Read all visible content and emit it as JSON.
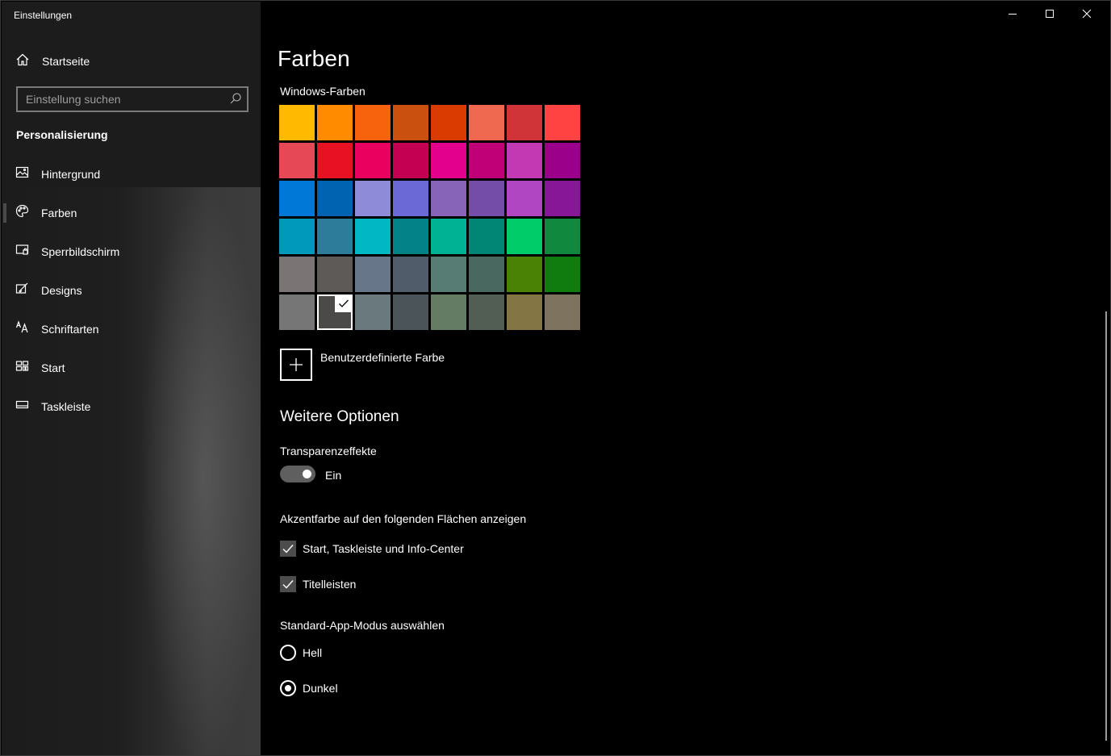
{
  "window": {
    "title": "Einstellungen"
  },
  "sidebar": {
    "home_label": "Startseite",
    "search_placeholder": "Einstellung suchen",
    "section_title": "Personalisierung",
    "items": [
      {
        "label": "Hintergrund",
        "icon": "picture-icon"
      },
      {
        "label": "Farben",
        "icon": "palette-icon",
        "active": true
      },
      {
        "label": "Sperrbildschirm",
        "icon": "lockscreen-icon"
      },
      {
        "label": "Designs",
        "icon": "brush-icon"
      },
      {
        "label": "Schriftarten",
        "icon": "font-icon"
      },
      {
        "label": "Start",
        "icon": "start-tiles-icon"
      },
      {
        "label": "Taskleiste",
        "icon": "taskbar-icon"
      }
    ]
  },
  "main": {
    "title": "Farben",
    "windows_colors_label": "Windows-Farben",
    "swatches": [
      [
        "#FFB900",
        "#FF8C00",
        "#F7630C",
        "#CA5010",
        "#DA3B01",
        "#EF6950",
        "#D13438",
        "#FF4343"
      ],
      [
        "#E74856",
        "#E81123",
        "#EA005E",
        "#C30052",
        "#E3008C",
        "#BF0077",
        "#C239B3",
        "#9A0089"
      ],
      [
        "#0078D7",
        "#0063B1",
        "#8E8CD8",
        "#6B69D6",
        "#8764B8",
        "#744DA9",
        "#B146C2",
        "#881798"
      ],
      [
        "#0099BC",
        "#2D7D9A",
        "#00B7C3",
        "#038387",
        "#00B294",
        "#018574",
        "#00CC6A",
        "#10893E"
      ],
      [
        "#7A7574",
        "#5D5A58",
        "#68768A",
        "#515C6B",
        "#567C73",
        "#486860",
        "#498205",
        "#107C10"
      ],
      [
        "#767676",
        "#4C4A48",
        "#69797E",
        "#4A5459",
        "#647C64",
        "#525E54",
        "#847545",
        "#7E735F"
      ]
    ],
    "selected_swatch": {
      "row": 5,
      "col": 1
    },
    "custom_color_label": "Benutzerdefinierte Farbe",
    "more_options_title": "Weitere Optionen",
    "transparency_label": "Transparenzeffekte",
    "transparency_state": "Ein",
    "accent_surfaces_label": "Akzentfarbe auf den folgenden Flächen anzeigen",
    "checkbox_start": "Start, Taskleiste und Info-Center",
    "checkbox_titlebars": "Titelleisten",
    "app_mode_label": "Standard-App-Modus auswählen",
    "radio_light": "Hell",
    "radio_dark": "Dunkel",
    "selected_mode": "Dunkel"
  }
}
